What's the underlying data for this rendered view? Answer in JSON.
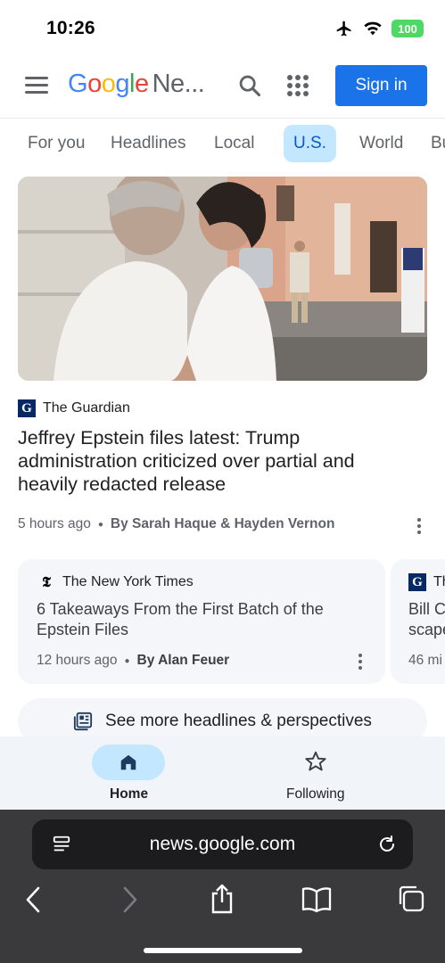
{
  "status_bar": {
    "time": "10:26",
    "battery": "100"
  },
  "header": {
    "logo_letters": [
      {
        "ch": "G",
        "color": "#4285F4"
      },
      {
        "ch": "o",
        "color": "#EA4335"
      },
      {
        "ch": "o",
        "color": "#FBBC05"
      },
      {
        "ch": "g",
        "color": "#4285F4"
      },
      {
        "ch": "l",
        "color": "#34A853"
      },
      {
        "ch": "e",
        "color": "#EA4335"
      }
    ],
    "logo_suffix": "Ne...",
    "sign_in": "Sign in"
  },
  "tabs": [
    "For you",
    "Headlines",
    "Local",
    "U.S.",
    "World",
    "Bu"
  ],
  "active_tab": "U.S.",
  "hero": {
    "source": "The Guardian",
    "source_logo": "G",
    "headline": "Jeffrey Epstein files latest: Trump administration criticized over partial and heavily redacted release",
    "time": "5 hours ago",
    "byline": "By Sarah Haque & Hayden Vernon"
  },
  "card1": {
    "source": "The New York Times",
    "source_logo": "𝕿",
    "title": "6 Takeaways From the First Batch of the Epstein Files",
    "time": "12 hours ago",
    "byline": "By Alan Feuer"
  },
  "card2": {
    "source": "Th",
    "title": "Bill C scape",
    "time": "46 mi"
  },
  "more_headlines": "See more headlines & perspectives",
  "bottom_nav": {
    "home": "Home",
    "following": "Following"
  },
  "browser": {
    "url": "news.google.com"
  }
}
